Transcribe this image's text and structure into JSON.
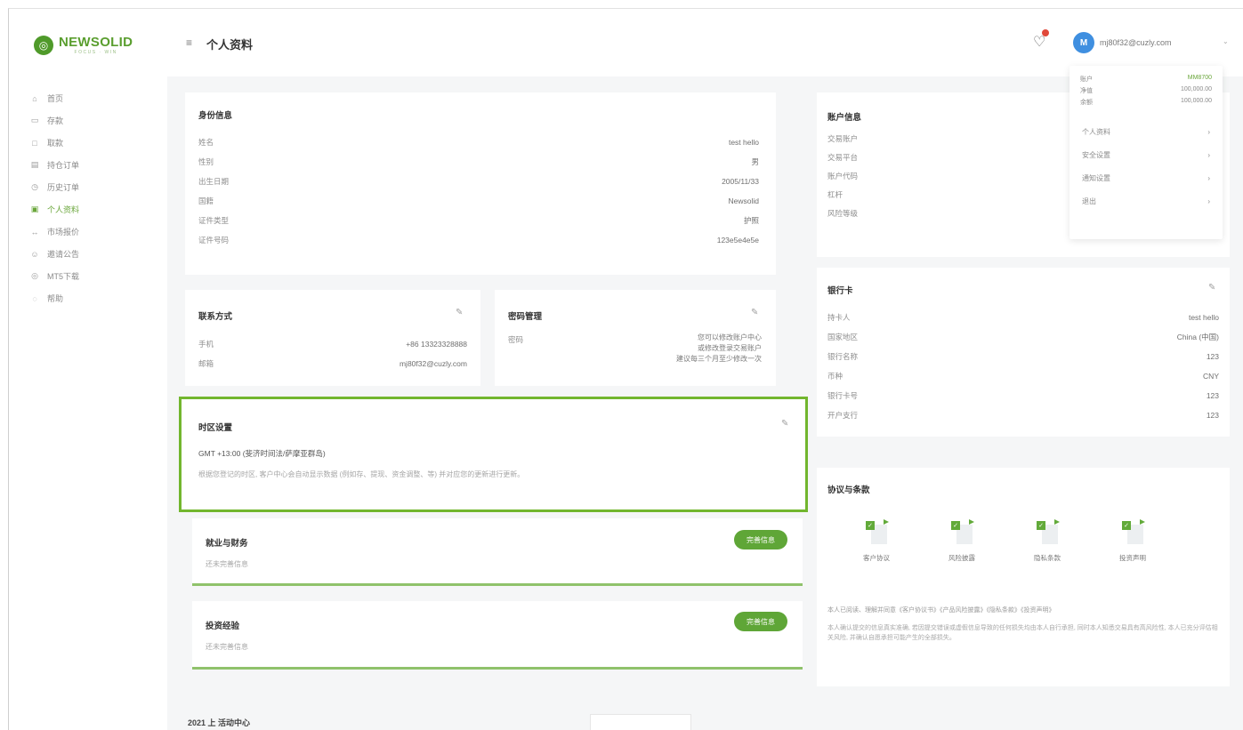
{
  "brand": {
    "name": "NEWSOLID",
    "tagline": "FOCUS · WIN"
  },
  "nav": [
    {
      "icon": "⌂",
      "icon_name": "home-icon",
      "label": "首页",
      "active": false
    },
    {
      "icon": "▭",
      "icon_name": "deposit-icon",
      "label": "存款",
      "active": false
    },
    {
      "icon": "□",
      "icon_name": "withdraw-icon",
      "label": "取款",
      "active": false
    },
    {
      "icon": "▤",
      "icon_name": "pending-order-icon",
      "label": "持仓订单",
      "active": false
    },
    {
      "icon": "◷",
      "icon_name": "history-order-icon",
      "label": "历史订单",
      "active": false
    },
    {
      "icon": "▣",
      "icon_name": "profile-icon",
      "label": "个人资料",
      "active": true
    },
    {
      "icon": "↔",
      "icon_name": "market-icon",
      "label": "市场报价",
      "active": false
    },
    {
      "icon": "☺",
      "icon_name": "invite-icon",
      "label": "邀请公告",
      "active": false
    },
    {
      "icon": "◎",
      "icon_name": "mt5-download-icon",
      "label": "MT5下载",
      "active": false
    },
    {
      "icon": "◌",
      "icon_name": "help-icon",
      "label": "帮助",
      "active": false
    }
  ],
  "header": {
    "menu_icon": "≡",
    "title": "个人资料",
    "bell_icon": "🔔",
    "avatar_initial": "M",
    "email": "mj80f32@cuzly.com",
    "caret": "⌄"
  },
  "identity": {
    "title": "身份信息",
    "rows": [
      {
        "k": "姓名",
        "v": "test hello"
      },
      {
        "k": "性别",
        "v": "男"
      },
      {
        "k": "出生日期",
        "v": "2005/11/33"
      },
      {
        "k": "国籍",
        "v": "Newsolid"
      },
      {
        "k": "证件类型",
        "v": "护照"
      },
      {
        "k": "证件号码",
        "v": "123e5e4e5e"
      }
    ]
  },
  "contact": {
    "title": "联系方式",
    "edit_icon": "✎",
    "rows": [
      {
        "k": "手机",
        "v": "+86 13323328888"
      },
      {
        "k": "邮箱",
        "v": "mj80f32@cuzly.com"
      }
    ]
  },
  "password": {
    "title": "密码管理",
    "edit_icon": "✎",
    "key": "密码",
    "lines": [
      "您可以修改账户中心",
      "或修改登录交易账户",
      "建议每三个月至少修改一次"
    ]
  },
  "timezone": {
    "title": "时区设置",
    "edit_icon": "✎",
    "value": "GMT +13:00 (斐济时间法/萨摩亚群岛)",
    "note": "根据您登记的时区, 客户中心会自动显示数据 (例如存、提现、资金调整、等) 并对应您的更新进行更新。"
  },
  "employment": {
    "title": "就业与财务",
    "button": "完善信息",
    "placeholder": "还未完善信息"
  },
  "investment": {
    "title": "投资经验",
    "button": "完善信息",
    "placeholder": "还未完善信息"
  },
  "footer_peek": {
    "title": "2021 上 活动中心"
  },
  "account": {
    "title": "账户信息",
    "rows": [
      "交易账户",
      "交易平台",
      "账户代码",
      "杠杆",
      "风险等级"
    ]
  },
  "bank": {
    "title": "银行卡",
    "edit_icon": "✎",
    "rows": [
      {
        "k": "持卡人",
        "v": "test hello"
      },
      {
        "k": "国家地区",
        "v": "China (中国)"
      },
      {
        "k": "银行名称",
        "v": "123"
      },
      {
        "k": "币种",
        "v": "CNY"
      },
      {
        "k": "银行卡号",
        "v": "123"
      },
      {
        "k": "开户支行",
        "v": "123"
      }
    ]
  },
  "agreements": {
    "title": "协议与条款",
    "docs": [
      "客户协议",
      "风险披露",
      "隐私条款",
      "投资声明"
    ],
    "line1": "本人已阅读、理解并同意《客户协议书》《产品风险披露》《隐私条款》《投资声明》",
    "line2": "本人确认提交的信息真实准确, 若因提交错误或虚假信息导致的任何损失均由本人自行承担, 同时本人知悉交易具有高风险性, 本人已充分评估相关风险, 并确认自愿承担可能产生的全部损失。"
  },
  "dropdown": {
    "balances": [
      {
        "k": "账户",
        "v": "MM8700"
      },
      {
        "k": "净值",
        "v": "100,000.00"
      },
      {
        "k": "余额",
        "v": "100,000.00"
      }
    ],
    "items": [
      "个人资料",
      "安全设置",
      "通知设置",
      "退出"
    ],
    "chevron": "›"
  },
  "colors": {
    "brand_green": "#5fa637",
    "highlight_border": "#72b62e"
  }
}
